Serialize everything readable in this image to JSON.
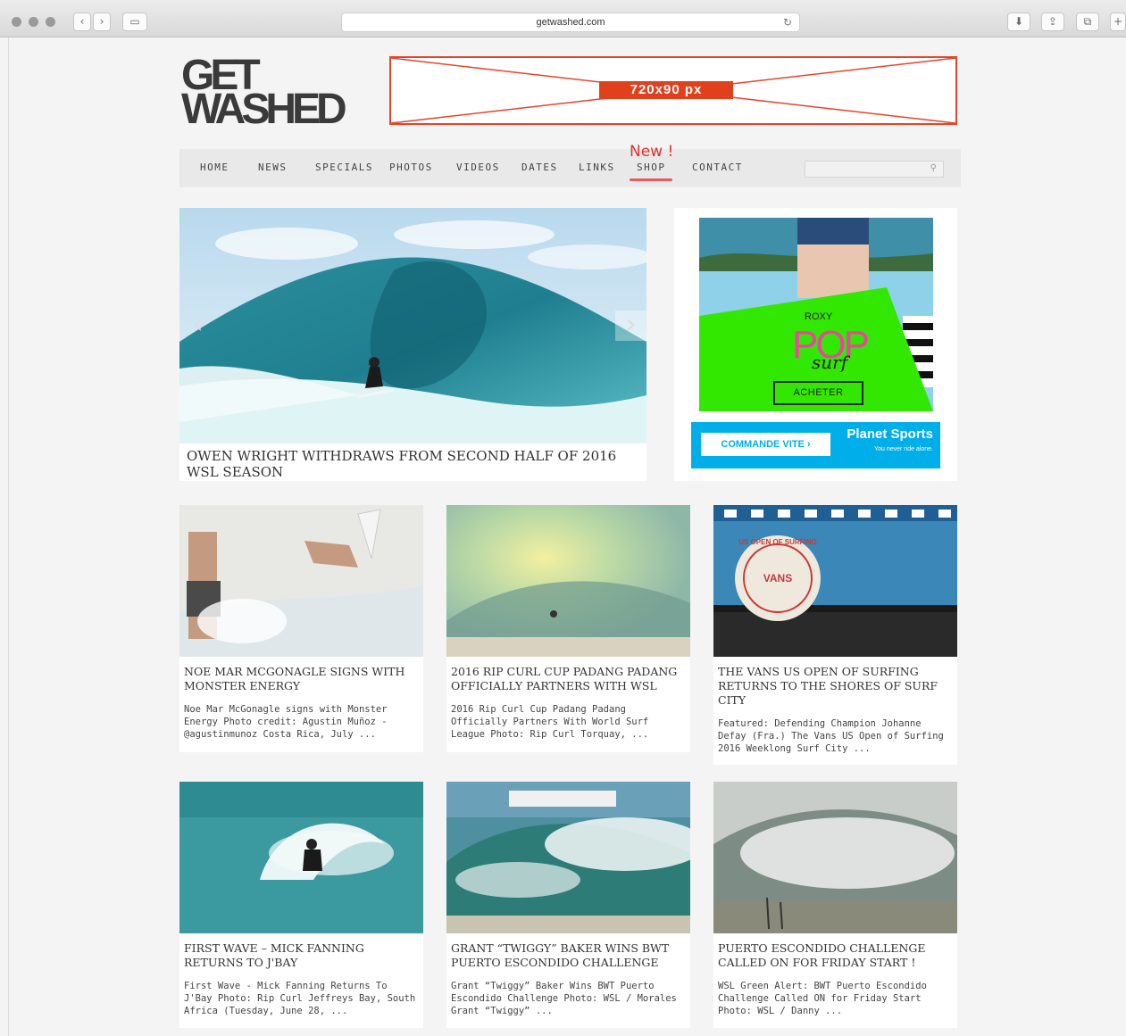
{
  "browser": {
    "url": "getwashed.com"
  },
  "header": {
    "logo_line1": "GET",
    "logo_line2": "WASHED",
    "banner_label": "720x90 px"
  },
  "nav": {
    "items": [
      "HOME",
      "NEWS",
      "SPECIALS",
      "PHOTOS",
      "VIDEOS",
      "DATES",
      "LINKS",
      "SHOP",
      "CONTACT"
    ],
    "new_badge": "New !",
    "search_placeholder": ""
  },
  "hero": {
    "caption": "OWEN WRIGHT WITHDRAWS FROM SECOND HALF OF 2016 WSL SEASON",
    "prev_arrow": "‹",
    "next_arrow": "›"
  },
  "ad": {
    "brand": "ROXY",
    "headline": "POP",
    "script": "surf",
    "cta": "ACHETER",
    "strip_cta": "COMMANDE VITE ›",
    "sponsor": "Planet Sports",
    "sponsor_tagline": "You never ride alone.",
    "accent_color": "#33e800"
  },
  "cards": [
    {
      "title": "NOE MAR MCGONAGLE SIGNS WITH MONSTER ENERGY",
      "excerpt": "Noe Mar McGonagle signs with Monster Energy Photo credit: Agustin Muñoz - @agustinmunoz   Costa Rica, July ..."
    },
    {
      "title": "2016 RIP CURL CUP PADANG PADANG OFFICIALLY PARTNERS WITH WSL",
      "excerpt": "2016 Rip Curl Cup Padang Padang Officially Partners With World Surf League Photo: Rip Curl   Torquay, ..."
    },
    {
      "title": "THE VANS US OPEN OF SURFING RETURNS TO THE SHORES OF SURF CITY",
      "excerpt": "Featured: Defending Champion Johanne Defay (Fra.)   The Vans US Open of Surfing 2016 Weeklong Surf City ..."
    },
    {
      "title": "FIRST WAVE – MICK FANNING RETURNS TO J'BAY",
      "excerpt": "First Wave - Mick Fanning Returns To J'Bay Photo: Rip Curl   Jeffreys Bay, South Africa (Tuesday, June 28, ..."
    },
    {
      "title": "GRANT “TWIGGY” BAKER WINS BWT PUERTO ESCONDIDO CHALLENGE",
      "excerpt": "Grant “Twiggy” Baker Wins BWT Puerto Escondido Challenge Photo: WSL / Morales Grant “Twiggy” ..."
    },
    {
      "title": "PUERTO ESCONDIDO CHALLENGE CALLED ON FOR FRIDAY START !",
      "excerpt": "WSL Green Alert: BWT Puerto Escondido Challenge Called ON for Friday Start Photo: WSL / Danny ..."
    }
  ],
  "card_badge": {
    "vans_text": "US OPEN OF SURFING",
    "vans_brand": "VANS"
  }
}
